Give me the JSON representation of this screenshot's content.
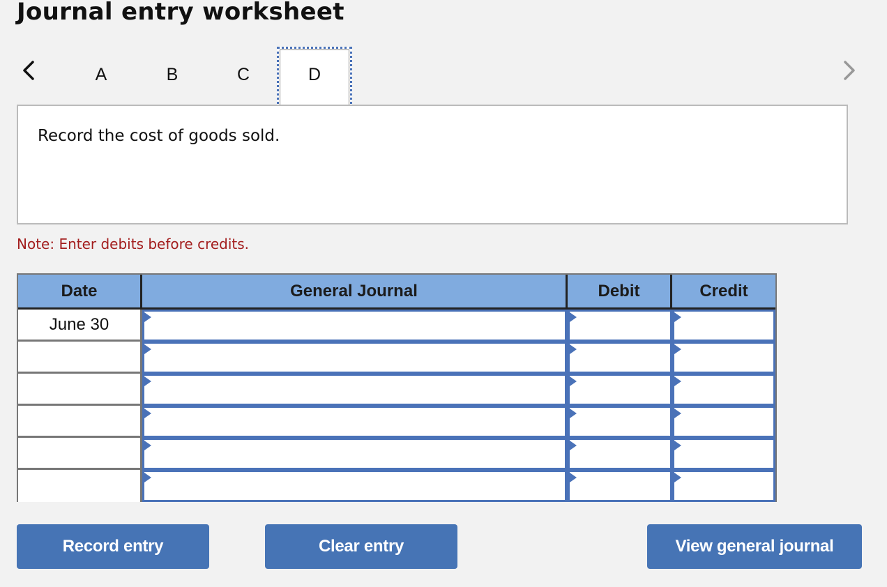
{
  "header": {
    "title": "Journal entry worksheet"
  },
  "navigation": {
    "prev_icon": "chevron-left-icon",
    "next_icon": "chevron-right-icon",
    "tabs": [
      {
        "label": "A",
        "active": false
      },
      {
        "label": "B",
        "active": false
      },
      {
        "label": "C",
        "active": false
      },
      {
        "label": "D",
        "active": true
      }
    ]
  },
  "prompt": {
    "text": "Record the cost of goods sold."
  },
  "note": "Note: Enter debits before credits.",
  "journal": {
    "columns": [
      "Date",
      "General Journal",
      "Debit",
      "Credit"
    ],
    "rows": [
      {
        "date": "June 30",
        "account": "",
        "debit": "",
        "credit": ""
      },
      {
        "date": "",
        "account": "",
        "debit": "",
        "credit": ""
      },
      {
        "date": "",
        "account": "",
        "debit": "",
        "credit": ""
      },
      {
        "date": "",
        "account": "",
        "debit": "",
        "credit": ""
      },
      {
        "date": "",
        "account": "",
        "debit": "",
        "credit": ""
      },
      {
        "date": "",
        "account": "",
        "debit": "",
        "credit": ""
      }
    ]
  },
  "buttons": {
    "record": "Record entry",
    "clear": "Clear entry",
    "view": "View general journal"
  },
  "colors": {
    "accent": "#4674b5",
    "header_bg": "#80abdf",
    "note": "#a31e1e",
    "background": "#f2f2f2"
  }
}
